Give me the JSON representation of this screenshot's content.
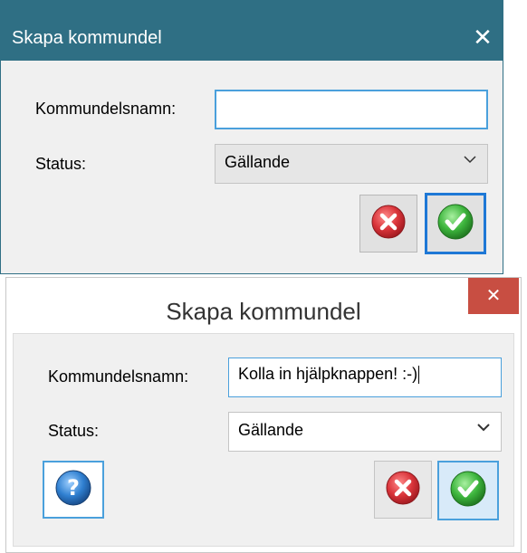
{
  "dialog1": {
    "title": "Skapa kommundel",
    "close_glyph": "✕",
    "name_label": "Kommundelsnamn:",
    "name_value": "",
    "status_label": "Status:",
    "status_value": "Gällande",
    "buttons": {
      "cancel_icon": "cancel-icon",
      "ok_icon": "checkmark-icon"
    }
  },
  "dialog2": {
    "title": "Skapa kommundel",
    "close_glyph": "✕",
    "name_label": "Kommundelsnamn:",
    "name_value": "Kolla in hjälpknappen! :-)",
    "status_label": "Status:",
    "status_value": "Gällande",
    "buttons": {
      "help_icon": "help-icon",
      "cancel_icon": "cancel-icon",
      "ok_icon": "checkmark-icon"
    }
  },
  "colors": {
    "titlebar_win10": "#2f6f84",
    "close_win8": "#c84e42",
    "focus_blue": "#4aa0dc",
    "cancel_red": "#d9343a",
    "ok_green": "#3db53d",
    "help_blue": "#2f7fd0"
  }
}
